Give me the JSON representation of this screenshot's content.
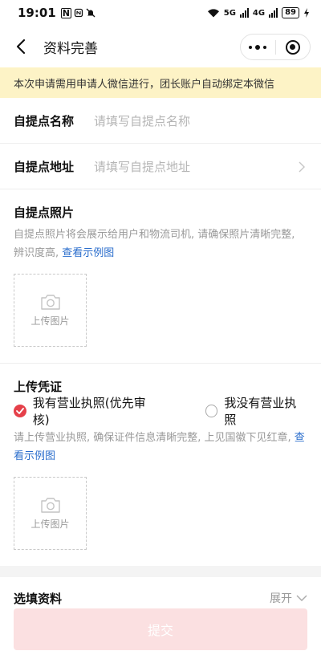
{
  "status_bar": {
    "time": "19:01",
    "left_icons": [
      "N",
      "nfc-icon",
      "mute-icon"
    ],
    "network1": "5G",
    "network2": "4G",
    "battery": "89"
  },
  "nav": {
    "title": "资料完善"
  },
  "notice": {
    "text": "本次申请需用申请人微信进行，团长账户自动绑定本微信"
  },
  "form": {
    "name_row": {
      "label": "自提点名称",
      "placeholder": "请填写自提点名称"
    },
    "address_row": {
      "label": "自提点地址",
      "placeholder": "请填写自提点地址"
    }
  },
  "photos": {
    "title": "自提点照片",
    "desc": "自提点照片将会展示给用户和物流司机, 请确保照片清晰完整, 辨识度高, ",
    "link": "查看示例图",
    "upload_label": "上传图片"
  },
  "credential": {
    "title": "上传凭证",
    "option_yes": "我有营业执照(优先审核)",
    "option_no": "我没有营业执照",
    "selected": "option_yes",
    "desc": "请上传营业执照, 确保证件信息清晰完整, 上见国徽下见红章, ",
    "link": "查看示例图",
    "upload_label": "上传图片"
  },
  "optional": {
    "label": "选填资料",
    "expand": "展开"
  },
  "submit": {
    "label": "提交"
  },
  "colors": {
    "accent": "#e5404a",
    "link": "#2a6dcc",
    "notice_bg": "#fdf3c6",
    "submit_disabled_bg": "#fbe0e1"
  }
}
